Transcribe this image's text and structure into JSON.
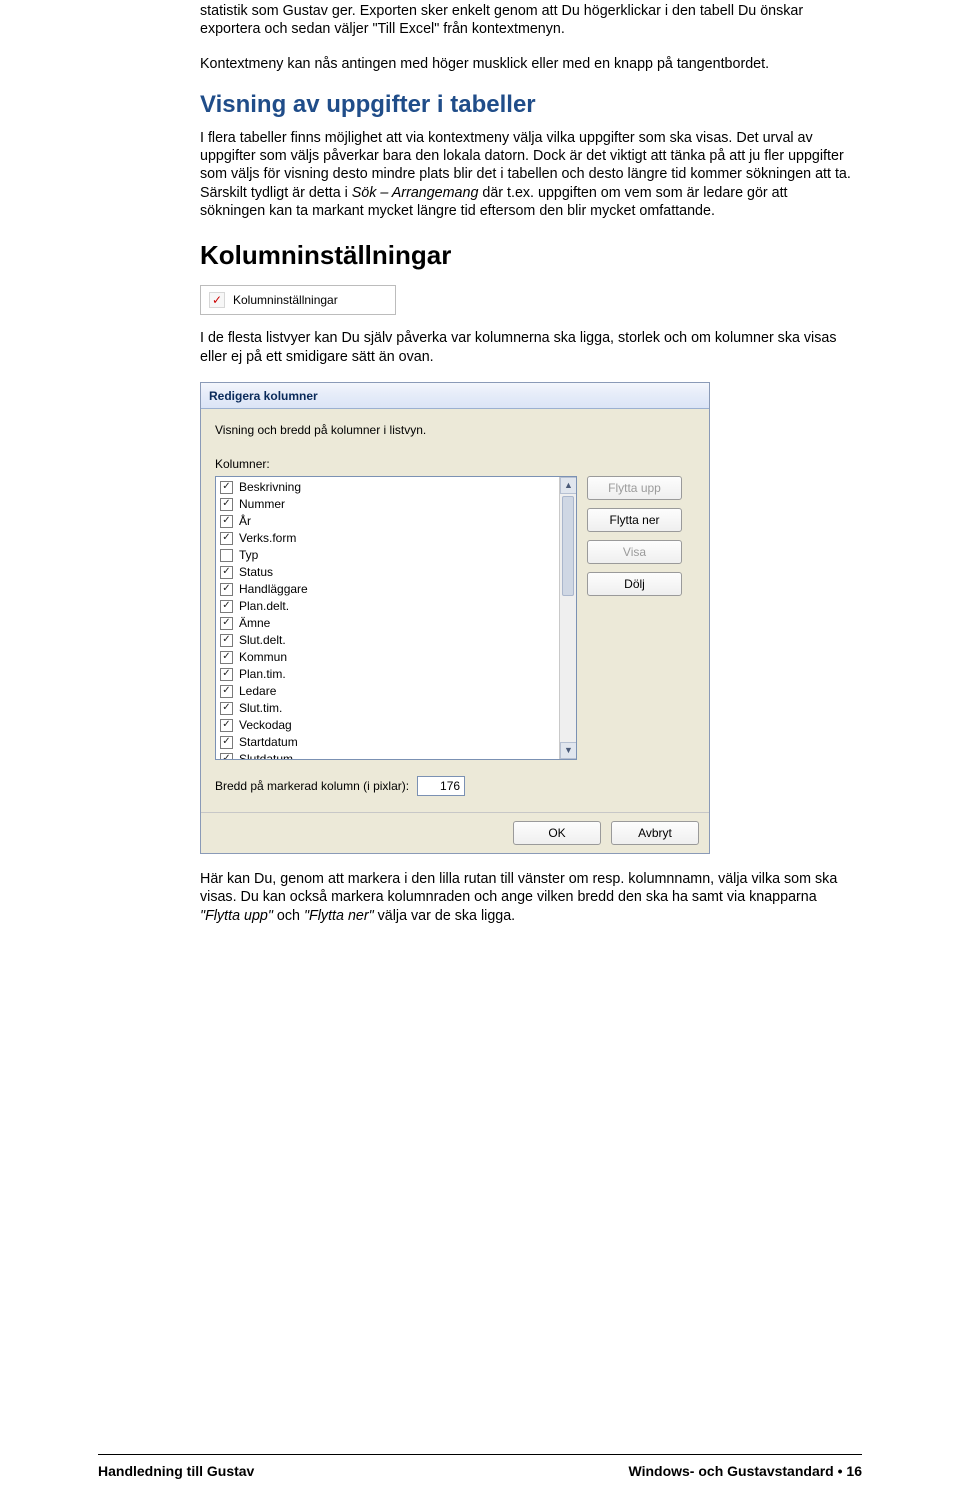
{
  "para1_a": "statistik som Gustav ger. Exporten sker enkelt genom att Du högerklickar i den tabell Du önskar exportera och sedan väljer \"Till Excel\" från kontextmenyn.",
  "para1_b": "Kontextmeny kan nås antingen med höger musklick eller med en knapp på tangentbordet.",
  "h2a": "Visning av uppgifter i tabeller",
  "para2_a": "I flera tabeller finns möjlighet att via kontextmeny välja vilka uppgifter som ska visas. Det urval av uppgifter som väljs påverkar bara den lokala datorn. Dock är det viktigt att tänka på att ju fler uppgifter som väljs för visning desto mindre plats blir det i tabellen och desto längre tid kommer sökningen att ta. Särskilt tydligt är detta i ",
  "para2_it1": "Sök – Arrangemang ",
  "para2_b": "där t.ex. uppgiften om vem som är ledare gör att sökningen kan ta markant mycket längre tid eftersom den blir mycket omfattande.",
  "h2b": "Kolumninställningar",
  "mini_label": "Kolumninställningar",
  "para3": "I de flesta listvyer kan Du själv påverka var kolumnerna ska ligga, storlek och om kolumner ska visas eller ej på ett smidigare sätt än ovan.",
  "dlg": {
    "title": "Redigera kolumner",
    "desc": "Visning och bredd på kolumner i listvyn.",
    "label": "Kolumner:",
    "items": [
      {
        "c": true,
        "t": "Beskrivning"
      },
      {
        "c": true,
        "t": "Nummer"
      },
      {
        "c": true,
        "t": "År"
      },
      {
        "c": true,
        "t": "Verks.form"
      },
      {
        "c": false,
        "t": "Typ"
      },
      {
        "c": true,
        "t": "Status"
      },
      {
        "c": true,
        "t": "Handläggare"
      },
      {
        "c": true,
        "t": "Plan.delt."
      },
      {
        "c": true,
        "t": "Ämne"
      },
      {
        "c": true,
        "t": "Slut.delt."
      },
      {
        "c": true,
        "t": "Kommun"
      },
      {
        "c": true,
        "t": "Plan.tim."
      },
      {
        "c": true,
        "t": "Ledare"
      },
      {
        "c": true,
        "t": "Slut.tim."
      },
      {
        "c": true,
        "t": "Veckodag"
      },
      {
        "c": true,
        "t": "Startdatum"
      },
      {
        "c": true,
        "t": "Slutdatum"
      }
    ],
    "btn_up": "Flytta upp",
    "btn_down": "Flytta ner",
    "btn_show": "Visa",
    "btn_hide": "Dölj",
    "width_label": "Bredd på markerad kolumn (i pixlar):",
    "width_val": "176",
    "ok": "OK",
    "cancel": "Avbryt"
  },
  "para4_a": "Här kan Du, genom att markera i den lilla rutan till vänster om resp. kolumnnamn, välja vilka som ska visas. Du kan också markera kolumnraden och ange vilken bredd den ska ha samt via knapparna ",
  "para4_it1": "\"Flytta upp\"",
  "para4_b": " och ",
  "para4_it2": "\"Flytta ner\"",
  "para4_c": " välja var de ska ligga.",
  "footer": {
    "left": "Handledning till Gustav",
    "right_a": "Windows- och Gustavstandard",
    "right_b": "16"
  }
}
